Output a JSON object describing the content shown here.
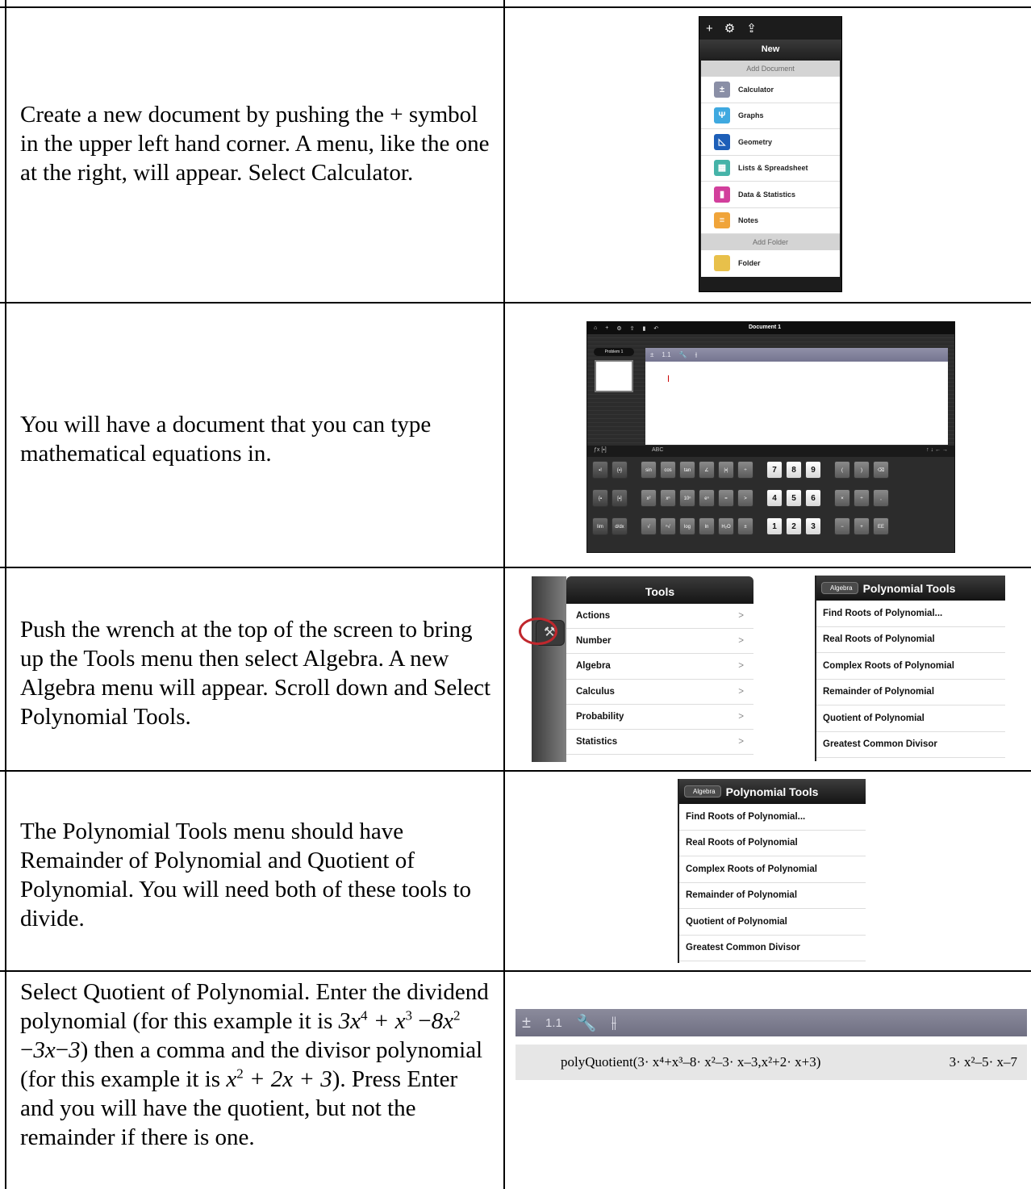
{
  "rows": [
    {
      "text": "Create a new document by pushing the + symbol in the upper left hand corner.  A menu, like the one at the right, will appear.  Select Calculator."
    },
    {
      "text": "You will have a document that you can type mathematical equations in."
    },
    {
      "text": "Push the wrench at the top of the screen to bring up the Tools menu then select Algebra.  A new Algebra menu will appear.  Scroll down and Select Polynomial Tools."
    },
    {
      "text": "The Polynomial Tools menu should have Remainder of Polynomial and Quotient of Polynomial.  You will need both of these tools to divide."
    },
    {
      "text_a": "Select Quotient of Polynomial.  Enter the dividend polynomial (for this example it is",
      "text_b": ") then a comma and the divisor polynomial (for this example it is",
      "text_c": ").  Press Enter and you will have the quotient, but not the remainder if there is one."
    }
  ],
  "new_menu": {
    "toolbar": [
      "+",
      "⚙",
      "⇪"
    ],
    "title": "New",
    "section1": "Add Document",
    "items": [
      {
        "label": "Calculator",
        "icon": "calculator-icon",
        "color": "#8a8fa6"
      },
      {
        "label": "Graphs",
        "icon": "graphs-icon",
        "color": "#3fa9e0"
      },
      {
        "label": "Geometry",
        "icon": "geometry-icon",
        "color": "#1d5fb8"
      },
      {
        "label": "Lists & Spreadsheet",
        "icon": "spreadsheet-icon",
        "color": "#45b3a8"
      },
      {
        "label": "Data & Statistics",
        "icon": "statistics-icon",
        "color": "#d23f9c"
      },
      {
        "label": "Notes",
        "icon": "notes-icon",
        "color": "#f0a43a"
      }
    ],
    "section2": "Add Folder",
    "folder": "Folder"
  },
  "document": {
    "title": "Document 1",
    "problem": "Problem 1",
    "page": "1.1",
    "kb_left": "ABC"
  },
  "tools_menu": {
    "title": "Tools",
    "items": [
      "Actions",
      "Number",
      "Algebra",
      "Calculus",
      "Probability",
      "Statistics"
    ]
  },
  "poly_menu": {
    "back": "Algebra",
    "title": "Polynomial Tools",
    "items": [
      "Find Roots of Polynomial...",
      "Real Roots of Polynomial",
      "Complex Roots of Polynomial",
      "Remainder of Polynomial",
      "Quotient of Polynomial",
      "Greatest Common Divisor"
    ]
  },
  "entry": {
    "page": "1.1",
    "input": "polyQuotient(3· x⁴+x³–8· x²–3· x–3,x²+2· x+3)",
    "result": "3· x²–5· x–7"
  }
}
